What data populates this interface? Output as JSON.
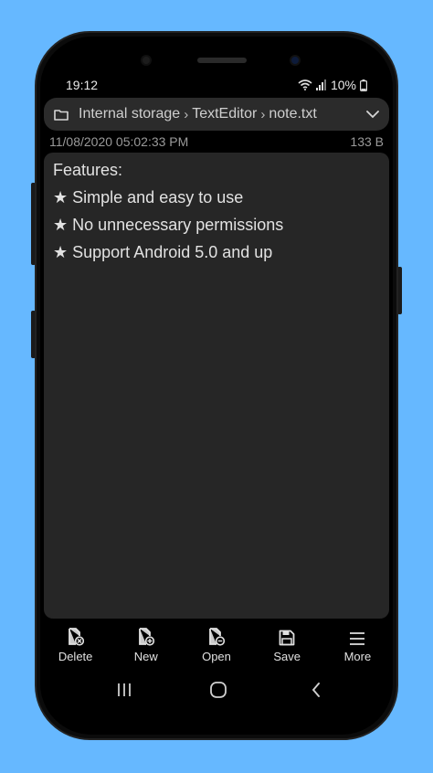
{
  "status": {
    "time": "19:12",
    "battery": "10%"
  },
  "path": {
    "root": "Internal storage",
    "folder": "TextEditor",
    "file": "note.txt",
    "separator": "›"
  },
  "meta": {
    "modified": "11/08/2020 05:02:33 PM",
    "size": "133 B"
  },
  "editor": {
    "lines": [
      "Features:",
      "★ Simple and easy to use",
      "★ No unnecessary permissions",
      "★ Support Android 5.0 and up"
    ]
  },
  "toolbar": {
    "items": [
      {
        "label": "Delete",
        "icon": "file-delete-icon"
      },
      {
        "label": "New",
        "icon": "file-new-icon"
      },
      {
        "label": "Open",
        "icon": "file-open-icon"
      },
      {
        "label": "Save",
        "icon": "save-icon"
      },
      {
        "label": "More",
        "icon": "menu-icon"
      }
    ]
  },
  "colors": {
    "background": "#66b8ff",
    "editor": "#262626",
    "pathbar": "#2b2b2b"
  }
}
